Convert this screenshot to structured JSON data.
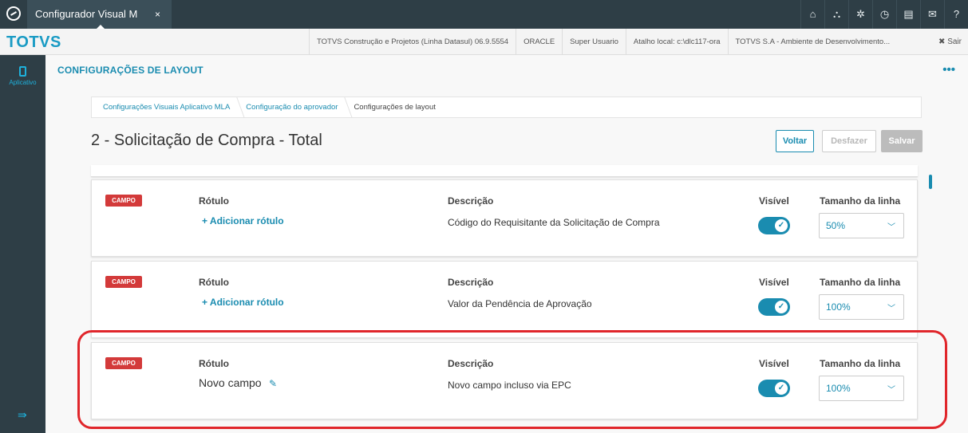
{
  "topbar": {
    "app_tab_label": "Configurador Visual M",
    "close_glyph": "×",
    "icons": [
      "home-icon",
      "sitemap-icon",
      "settings-icon",
      "clock-icon",
      "document-icon",
      "mail-icon",
      "help-icon"
    ],
    "icon_glyphs": [
      "⌂",
      "⛬",
      "✲",
      "◷",
      "▤",
      "✉",
      "?"
    ]
  },
  "infobar": {
    "brand": "TOTVS",
    "items": [
      "TOTVS Construção e Projetos (Linha Datasul) 06.9.5554",
      "ORACLE",
      "Super Usuario",
      "Atalho local: c:\\dlc117-ora",
      "TOTVS S.A - Ambiente de Desenvolvimento..."
    ],
    "sair_label": "✖ Sair"
  },
  "sidebar": {
    "item_label": "Aplicativo",
    "collapse_glyph": "⇛"
  },
  "main": {
    "title": "CONFIGURAÇÕES DE LAYOUT",
    "more_glyph": "•••",
    "breadcrumb": [
      "Configurações Visuais Aplicativo MLA",
      "Configuração do aprovador",
      "Configurações de layout"
    ],
    "page_title": "2 - Solicitação de Compra - Total",
    "buttons": {
      "voltar": "Voltar",
      "desfazer": "Desfazer",
      "salvar": "Salvar"
    }
  },
  "headers": {
    "rotulo": "Rótulo",
    "descricao": "Descrição",
    "visivel": "Visível",
    "tamanho": "Tamanho da linha"
  },
  "fields": [
    {
      "badge": "CAMPO",
      "rotulo": "",
      "add_rotulo": "+ Adicionar rótulo",
      "descricao": "Código do Requisitante da Solicitação de Compra",
      "visivel": true,
      "tamanho": "50%"
    },
    {
      "badge": "CAMPO",
      "rotulo": "",
      "add_rotulo": "+ Adicionar rótulo",
      "descricao": "Valor da Pendência de Aprovação",
      "visivel": true,
      "tamanho": "100%"
    },
    {
      "badge": "CAMPO",
      "rotulo": "Novo campo",
      "add_rotulo": "",
      "descricao": "Novo campo incluso via EPC",
      "visivel": true,
      "tamanho": "100%"
    }
  ],
  "colors": {
    "accent": "#1a8cb0",
    "badge": "#d33a3a",
    "highlight": "#e0262b",
    "topbar": "#2e3e46"
  }
}
